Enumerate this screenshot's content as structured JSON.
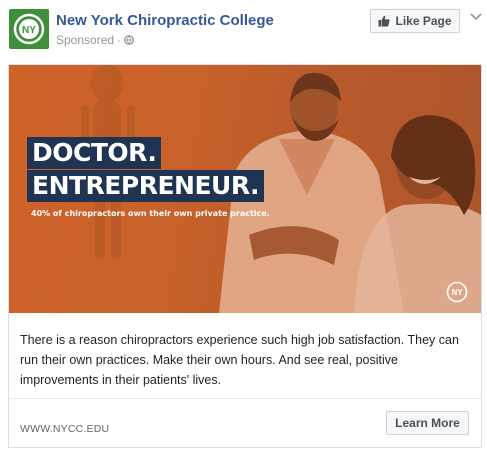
{
  "header": {
    "page_name": "New York Chiropractic College",
    "sponsored_label": "Sponsored",
    "separator": "·",
    "like_button_label": "Like Page",
    "avatar_text": "NY"
  },
  "ad": {
    "headline_line1": "DOCTOR.",
    "headline_line2": "ENTREPRENEUR.",
    "subline": "40% of chiropractors own their own private practice.",
    "logo_text": "NY",
    "body": "There is a reason chiropractors experience such high job satisfaction. They can run their own practices. Make their own hours. And see real, positive improvements in their patients' lives.",
    "display_url": "WWW.NYCC.EDU",
    "cta_label": "Learn More"
  },
  "colors": {
    "brand_green": "#3f8f3b",
    "link_blue": "#365899",
    "hero_orange": "#c9622a",
    "headline_navy": "#1f3352"
  },
  "icons": [
    "nycc-logo-icon",
    "globe-icon",
    "thumbs-up-icon",
    "chevron-down-icon",
    "nycc-hero-logo-icon"
  ]
}
